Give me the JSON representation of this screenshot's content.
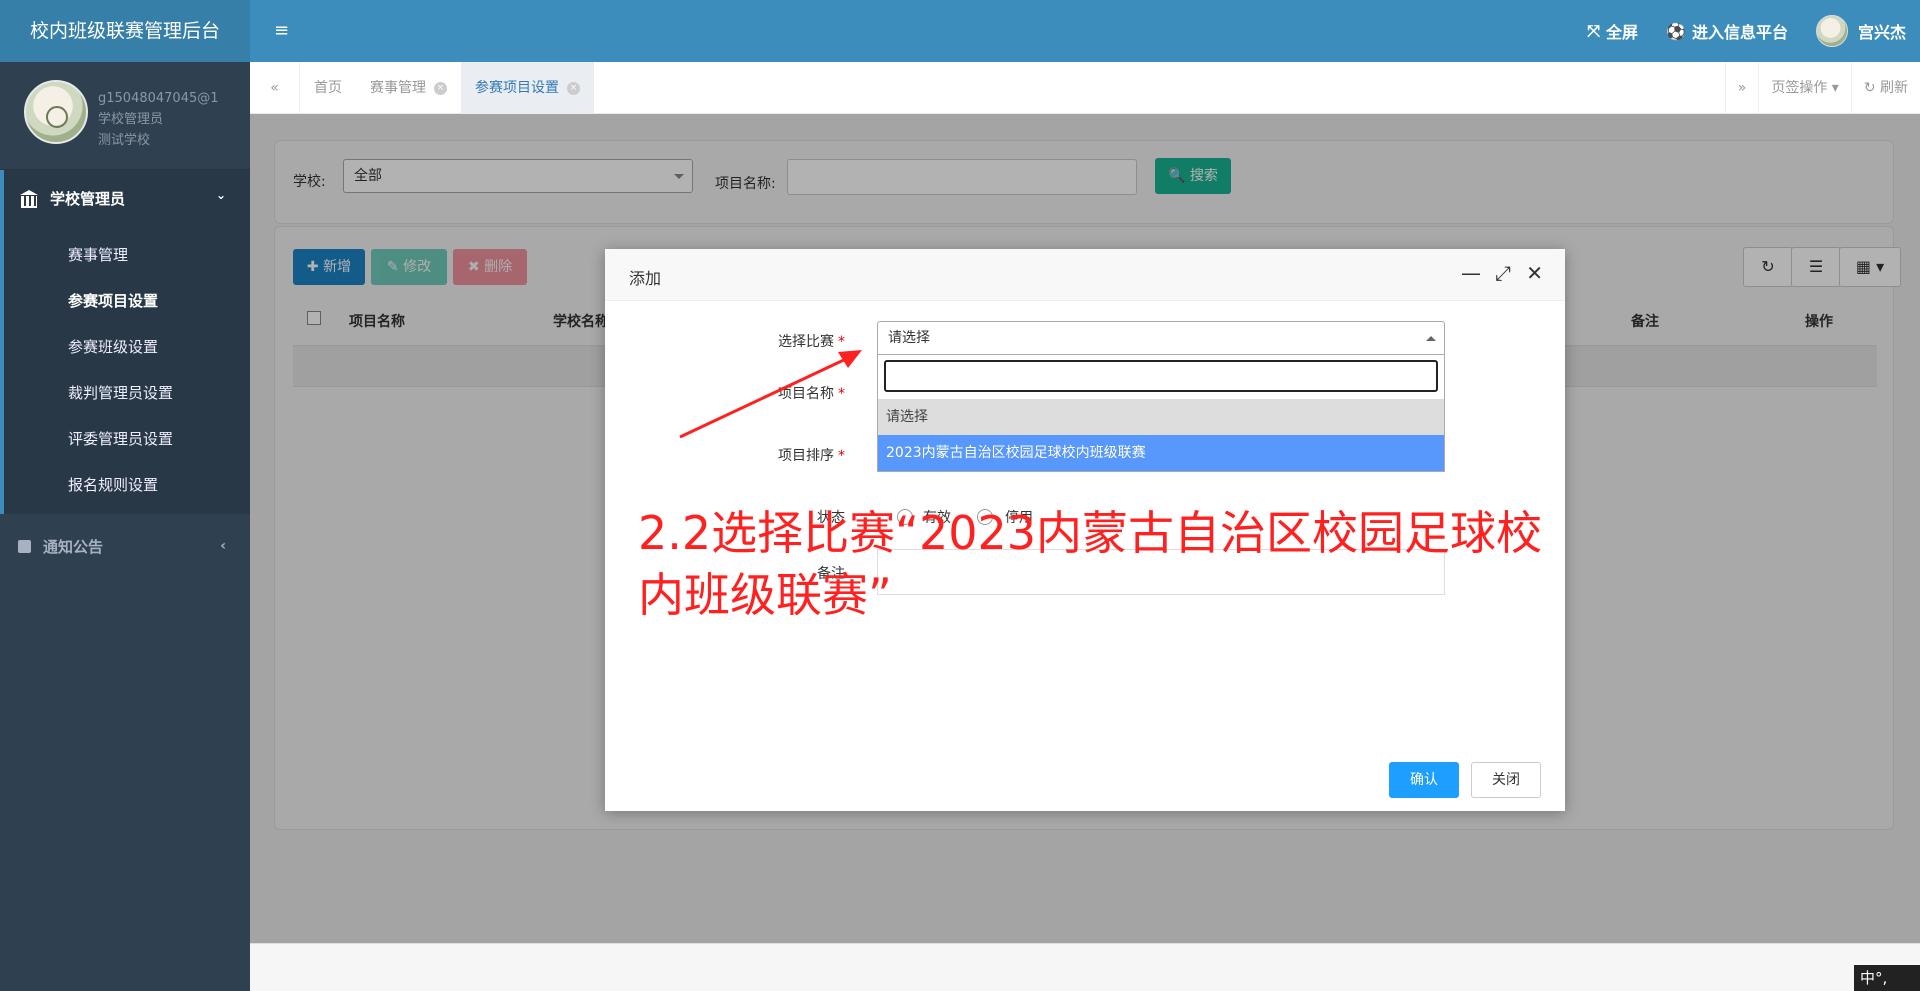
{
  "app": {
    "title": "校内班级联赛管理后台"
  },
  "user": {
    "account": "g15048047045@1",
    "role": "学校管理员",
    "school": "测试学校",
    "name": "宫兴杰"
  },
  "header": {
    "fullscreen": "全屏",
    "platform": "进入信息平台"
  },
  "sidebar": {
    "group_label": "学校管理员",
    "items": [
      {
        "label": "赛事管理"
      },
      {
        "label": "参赛项目设置"
      },
      {
        "label": "参赛班级设置"
      },
      {
        "label": "裁判管理员设置"
      },
      {
        "label": "评委管理员设置"
      },
      {
        "label": "报名规则设置"
      }
    ],
    "notice_label": "通知公告"
  },
  "tabs": [
    {
      "label": "首页"
    },
    {
      "label": "赛事管理"
    },
    {
      "label": "参赛项目设置"
    }
  ],
  "tab_actions": {
    "page_ops": "页签操作",
    "refresh": "刷新"
  },
  "search": {
    "school_label": "学校:",
    "school_value": "全部",
    "project_label": "项目名称:",
    "search_button": "搜索"
  },
  "toolbar": {
    "add": "新增",
    "edit": "修改",
    "delete": "删除"
  },
  "table": {
    "columns": [
      "项目名称",
      "学校名称",
      "备注",
      "操作"
    ]
  },
  "dialog": {
    "title": "添加",
    "fields": {
      "match_label": "选择比赛",
      "name_label": "项目名称",
      "order_label": "项目排序",
      "status_label": "状态",
      "status_on": "有效",
      "status_off": "停用",
      "remark_label": "备注"
    },
    "select_value": "请选择",
    "options": [
      "请选择",
      "2023内蒙古自治区校园足球校内班级联赛"
    ],
    "confirm": "确认",
    "close": "关闭"
  },
  "annotation": {
    "text": "2.2选择比赛“2023内蒙古自治区校园足球校内班级联赛”"
  },
  "ime": {
    "text": "中°,"
  },
  "colors": {
    "primary": "#3c8dbc",
    "sidebar": "#2f4050",
    "search_btn": "#1ab394",
    "add_btn": "#1c84c6",
    "edit_btn": "#1ab394",
    "delete_btn": "#ed5565",
    "option_highlight": "#5897fb",
    "annotation": "#ff2020"
  }
}
